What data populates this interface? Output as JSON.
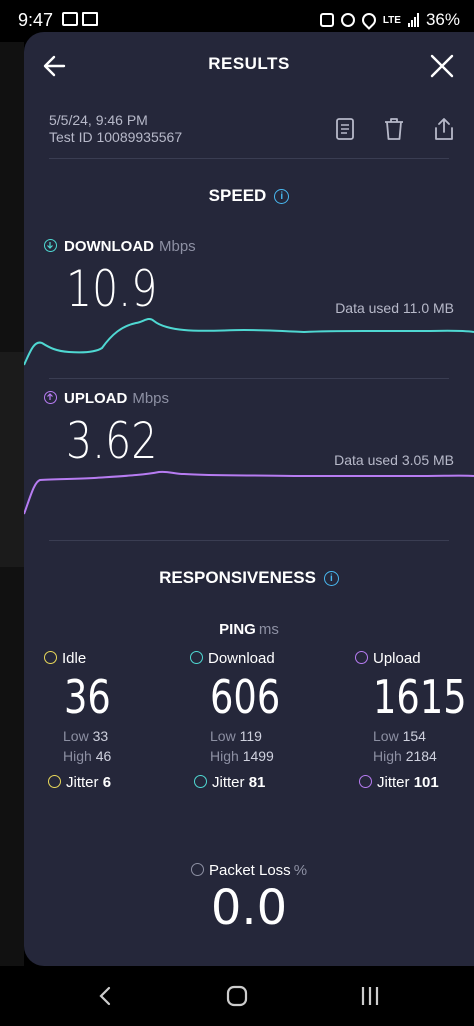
{
  "status_bar": {
    "time": "9:47",
    "battery": "36%",
    "network": "LTE"
  },
  "header": {
    "title": "RESULTS"
  },
  "meta": {
    "date": "5/5/24, 9:46 PM",
    "test_id": "Test ID 10089935567"
  },
  "speed": {
    "section_title": "SPEED",
    "download": {
      "label": "DOWNLOAD",
      "unit": "Mbps",
      "value": "10.9",
      "data_used": "Data used 11.0 MB",
      "color": "#4fd8d2"
    },
    "upload": {
      "label": "UPLOAD",
      "unit": "Mbps",
      "value": "3.62",
      "data_used": "Data used 3.05 MB",
      "color": "#b77cf2"
    }
  },
  "responsiveness": {
    "section_title": "RESPONSIVENESS",
    "ping_label": "PING",
    "ping_unit": "ms",
    "columns": [
      {
        "label": "Idle",
        "value": "36",
        "low_label": "Low",
        "low": "33",
        "high_label": "High",
        "high": "46",
        "jitter_label": "Jitter",
        "jitter": "6",
        "color": "#e8d85a"
      },
      {
        "label": "Download",
        "value": "606",
        "low_label": "Low",
        "low": "119",
        "high_label": "High",
        "high": "1499",
        "jitter_label": "Jitter",
        "jitter": "81",
        "color": "#4fd8d2"
      },
      {
        "label": "Upload",
        "value": "1615",
        "low_label": "Low",
        "low": "154",
        "high_label": "High",
        "high": "2184",
        "jitter_label": "Jitter",
        "jitter": "101",
        "color": "#b77cf2"
      }
    ],
    "packet_loss": {
      "label": "Packet Loss",
      "unit": "%",
      "value": "0.0"
    }
  },
  "icons": {
    "back": "arrow-left-icon",
    "close": "close-icon",
    "report": "document-icon",
    "delete": "trash-icon",
    "share": "share-icon",
    "info": "info-icon"
  }
}
